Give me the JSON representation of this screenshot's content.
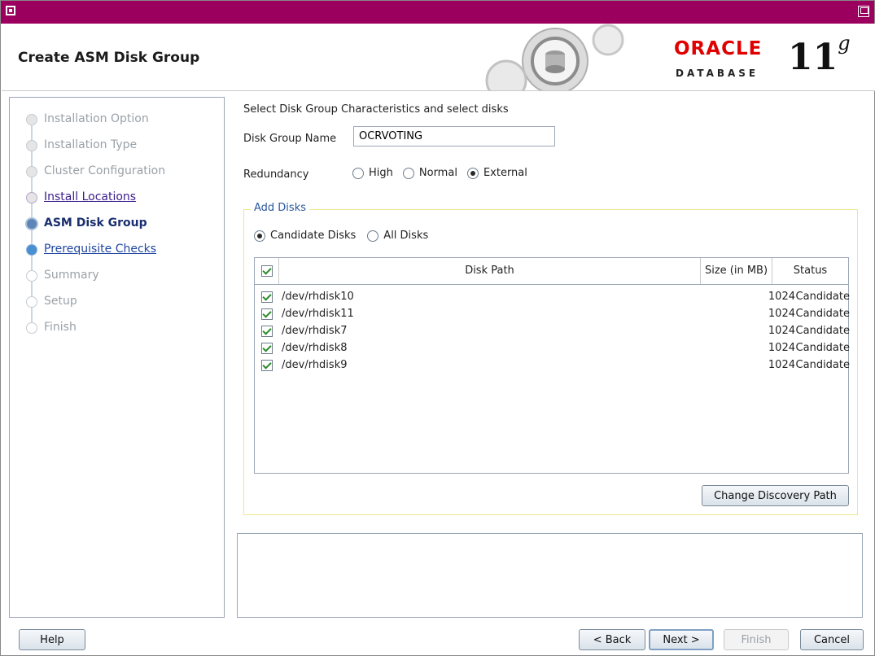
{
  "header": {
    "title": "Create ASM Disk Group",
    "oracle_brand": "ORACLE",
    "oracle_sub": "DATABASE",
    "version": "11",
    "version_suffix": "g"
  },
  "nav": {
    "items": [
      {
        "label": "Installation Option",
        "state": "done"
      },
      {
        "label": "Installation Type",
        "state": "done"
      },
      {
        "label": "Cluster Configuration",
        "state": "done"
      },
      {
        "label": "Install Locations",
        "state": "visited"
      },
      {
        "label": "ASM Disk Group",
        "state": "current"
      },
      {
        "label": "Prerequisite Checks",
        "state": "next"
      },
      {
        "label": "Summary",
        "state": "pending"
      },
      {
        "label": "Setup",
        "state": "pending"
      },
      {
        "label": "Finish",
        "state": "pending"
      }
    ]
  },
  "main": {
    "heading": "Select Disk Group Characteristics and select disks",
    "disk_group_name_label": "Disk Group Name",
    "disk_group_name_value": "OCRVOTING",
    "redundancy_label": "Redundancy",
    "redundancy_options": [
      {
        "label": "High",
        "selected": false
      },
      {
        "label": "Normal",
        "selected": false
      },
      {
        "label": "External",
        "selected": true
      }
    ],
    "add_disks_legend": "Add Disks",
    "disk_filter_options": [
      {
        "label": "Candidate Disks",
        "selected": true
      },
      {
        "label": "All Disks",
        "selected": false
      }
    ],
    "table": {
      "headers": [
        "Disk Path",
        "Size (in MB)",
        "Status"
      ],
      "rows": [
        {
          "checked": true,
          "path": "/dev/rhdisk10",
          "size": "1024",
          "status": "Candidate"
        },
        {
          "checked": true,
          "path": "/dev/rhdisk11",
          "size": "1024",
          "status": "Candidate"
        },
        {
          "checked": true,
          "path": "/dev/rhdisk7",
          "size": "1024",
          "status": "Candidate"
        },
        {
          "checked": true,
          "path": "/dev/rhdisk8",
          "size": "1024",
          "status": "Candidate"
        },
        {
          "checked": true,
          "path": "/dev/rhdisk9",
          "size": "1024",
          "status": "Candidate"
        }
      ]
    },
    "change_discovery_path_label": "Change Discovery Path"
  },
  "footer": {
    "help_label": "Help",
    "back_label": "< Back",
    "next_label": "Next >",
    "finish_label": "Finish",
    "cancel_label": "Cancel"
  },
  "colors": {
    "titlebar": "#9b005f",
    "oracle_red": "#e00000",
    "legend_blue": "#2b57a0",
    "fieldset_border": "#f0e78a"
  }
}
